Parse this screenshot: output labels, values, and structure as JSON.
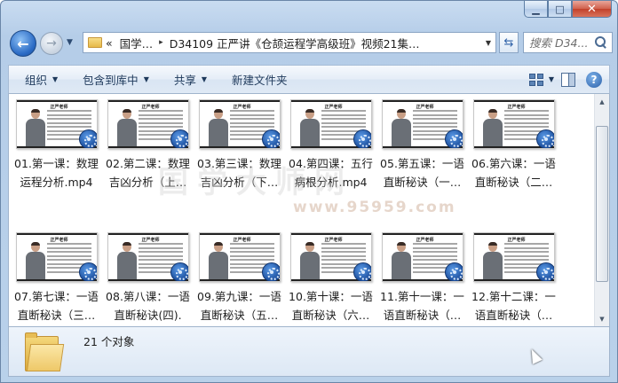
{
  "window": {
    "caption_buttons": {
      "minimize": "▁",
      "maximize": "□",
      "close": "✕"
    }
  },
  "nav": {
    "back_symbol": "←",
    "forward_symbol": "→",
    "dropdown_symbol": "▼"
  },
  "address": {
    "prefix": "«",
    "segments": [
      "国学…",
      "D34109 正严讲《仓颉运程学高级班》视频21集…"
    ],
    "separator": "▸",
    "dropdown": "▼",
    "refresh_symbol": "⇆"
  },
  "search": {
    "placeholder": "搜索 D34..."
  },
  "commands": [
    {
      "label": "组织",
      "has_arrow": true
    },
    {
      "label": "包含到库中",
      "has_arrow": true
    },
    {
      "label": "共享",
      "has_arrow": true
    },
    {
      "label": "新建文件夹",
      "has_arrow": false
    }
  ],
  "command_arrow": "▼",
  "help_symbol": "?",
  "thumbnail": {
    "slide_title": "正严老师"
  },
  "files": [
    {
      "name": "01.第一课：数理运程分析.mp4"
    },
    {
      "name": "02.第二课：数理吉凶分析（上…"
    },
    {
      "name": "03.第三课：数理吉凶分析（下…"
    },
    {
      "name": "04.第四课：五行病根分析.mp4"
    },
    {
      "name": "05.第五课：一语直断秘诀（一…"
    },
    {
      "name": "06.第六课：一语直断秘诀（二…"
    },
    {
      "name": "07.第七课：一语直断秘诀（三…"
    },
    {
      "name": "08.第八课：一语直断秘诀(四).m…"
    },
    {
      "name": "09.第九课：一语直断秘诀（五…"
    },
    {
      "name": "10.第十课：一语直断秘诀（六…"
    },
    {
      "name": "11.第十一课：一语直断秘诀（…"
    },
    {
      "name": "12.第十二课：一语直断秘诀（…"
    }
  ],
  "watermark": {
    "text": "国学大师网",
    "url": "www.95959.com"
  },
  "scrollbar": {
    "up": "▲",
    "down": "▼"
  },
  "status": {
    "item_count": "21 个对象"
  }
}
